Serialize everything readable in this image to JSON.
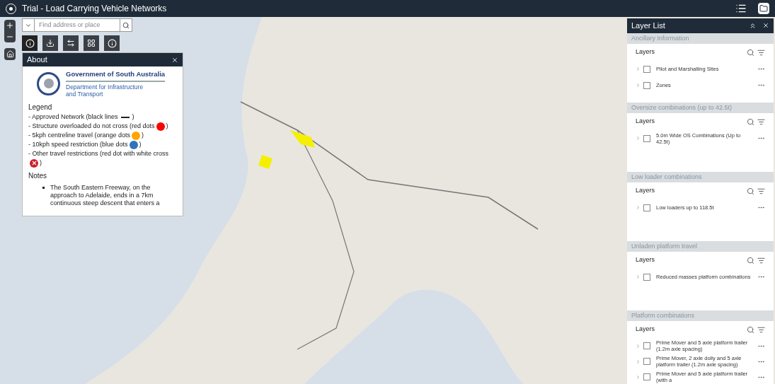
{
  "header": {
    "title": "Trial - Load Carrying Vehicle Networks"
  },
  "search": {
    "placeholder": "Find address or place"
  },
  "about": {
    "title": "About",
    "org": "Government of South Australia",
    "dept": "Department for Infrastructure and Transport",
    "legend_title": "Legend",
    "legend": [
      {
        "text": "- Approved Network (black lines",
        "kind": "line",
        "color": "#222222",
        "end": ")"
      },
      {
        "text": "- Structure overloaded do not cross (red dots",
        "kind": "dot",
        "color": "#ff0000",
        "end": ")"
      },
      {
        "text": "- 5kph centreline travel (orange dots",
        "kind": "dot",
        "color": "#ffa500",
        "end": ")"
      },
      {
        "text": "- 10kph speed restriction (blue dots",
        "kind": "dot",
        "color": "#2e74c0",
        "end": ")"
      },
      {
        "text": "- Other travel restrictions (red dot with white cross",
        "kind": "cross",
        "color": "#cc1f2a",
        "end": ")"
      }
    ],
    "notes_title": "Notes",
    "notes": [
      "The South Eastern Freeway, on the approach to Adelaide, ends in a 7km continuous steep descent that enters a"
    ]
  },
  "layer_list": {
    "title": "Layer List",
    "sections": [
      {
        "title": "Ancillary Information",
        "layers_label": "Layers",
        "items": [
          {
            "label": "Pilot and Marshalling Sites",
            "checked": false
          },
          {
            "label": "Zones",
            "checked": false
          }
        ]
      },
      {
        "title": "Oversize combinations (up to 42.5t)",
        "layers_label": "Layers",
        "items": [
          {
            "label": "5.0m Wide OS Combinations (Up to 42.5t)",
            "checked": false
          }
        ]
      },
      {
        "title": "Low loader combinations",
        "layers_label": "Layers",
        "items": [
          {
            "label": "Low loaders up to 118.5t",
            "checked": false
          }
        ]
      },
      {
        "title": "Unladen platform travel",
        "layers_label": "Layers",
        "items": [
          {
            "label": "Reduced masses platform combinations",
            "checked": false
          }
        ]
      },
      {
        "title": "Platform combinations",
        "layers_label": "Layers",
        "items": [
          {
            "label": "Prime Mover and 5 axle platform trailer (1.2m axle spacing)",
            "checked": false
          },
          {
            "label": "Prime Mover, 2 axle dolly and 5 axle platform trailer (1.2m axle spacing)",
            "checked": false
          },
          {
            "label": "Prime Mover and 5 axle platform trailer (with a",
            "checked": false
          }
        ]
      }
    ]
  }
}
